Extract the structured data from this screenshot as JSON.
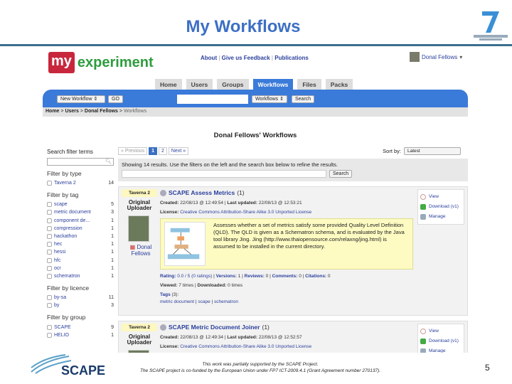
{
  "slide": {
    "title": "My Workflows",
    "page_number": "5",
    "footer_line1": "This work was partially supported by the SCAPE Project.",
    "footer_line2": "The SCAPE project is co-funded by the European Union under FP7 ICT-2009.4.1 (Grant Agreement number 270137).",
    "scape_logo": "SCAPE",
    "fp7_logo": "SEVENTH FRAMEWORK PROGRAMME"
  },
  "header": {
    "logo_my": "my",
    "logo_experiment": "experiment",
    "links": [
      "About",
      "Give us Feedback",
      "Publications"
    ],
    "user": "Donal Fellows"
  },
  "tabs": [
    "Home",
    "Users",
    "Groups",
    "Workflows",
    "Files",
    "Packs"
  ],
  "toolbar": {
    "new_select": "New Workflow",
    "go": "GO",
    "search_scope": "Workflows",
    "search": "Search"
  },
  "breadcrumb": {
    "home": "Home",
    "users": "Users",
    "user": "Donal Fellows",
    "current": "Workflows"
  },
  "page_title": "Donal Fellows' Workflows",
  "sidebar": {
    "search_label": "Search filter terms",
    "groups": [
      {
        "title": "Filter by type",
        "items": [
          {
            "label": "Taverna 2",
            "count": "14"
          }
        ]
      },
      {
        "title": "Filter by tag",
        "items": [
          {
            "label": "scape",
            "count": "5"
          },
          {
            "label": "metric document",
            "count": "3"
          },
          {
            "label": "component de...",
            "count": "1"
          },
          {
            "label": "compression",
            "count": "1"
          },
          {
            "label": "hackathon",
            "count": "1"
          },
          {
            "label": "hec",
            "count": "1"
          },
          {
            "label": "hessi",
            "count": "1"
          },
          {
            "label": "hfc",
            "count": "1"
          },
          {
            "label": "ocr",
            "count": "1"
          },
          {
            "label": "schematron",
            "count": "1"
          }
        ]
      },
      {
        "title": "Filter by licence",
        "items": [
          {
            "label": "by-sa",
            "count": "11"
          },
          {
            "label": "by",
            "count": "3"
          }
        ]
      },
      {
        "title": "Filter by group",
        "items": [
          {
            "label": "SCAPE",
            "count": "9"
          },
          {
            "label": "HELIO",
            "count": "1"
          }
        ]
      }
    ]
  },
  "main": {
    "pager": {
      "prev": "« Previous",
      "p1": "1",
      "p2": "2",
      "next": "Next »"
    },
    "sort_label": "Sort by:",
    "sort_value": "Latest",
    "info": "Showing 14 results. Use the filters on the left and the search box below to refine the results.",
    "search": "Search",
    "cards": [
      {
        "type": "Taverna 2",
        "uploader_label": "Original Uploader",
        "uploader": "Donal Fellows",
        "title": "SCAPE Assess Metrics",
        "count": "(1)",
        "created_label": "Created:",
        "created": "22/08/13 @ 12:49:54",
        "updated_label": "Last updated:",
        "updated": "22/08/13 @ 12:53:21",
        "license_label": "License:",
        "license": "Creative Commons Attribution-Share Alike 3.0 Unported License",
        "description": "Assesses whether a set of metrics satisfy some provided Quality Level Definition (QLD). The QLD is given as a Schematron schema, and is evaluated by the Java tool library Jing. Jing (http://www.thaiopensource.com/relaxng/jing.html) is assumed to be installed in the current directory.",
        "rating_label": "Rating:",
        "rating": "0.0 / 5 (0 ratings)",
        "versions_label": "Versions:",
        "versions": "1",
        "reviews_label": "Reviews:",
        "reviews": "0",
        "comments_label": "Comments:",
        "comments": "0",
        "citations_label": "Citations:",
        "citations": "0",
        "viewed_label": "Viewed:",
        "viewed": "7 times",
        "downloaded_label": "Downloaded:",
        "downloaded": "0 times",
        "tags_label": "Tags",
        "tags_count": "(3):",
        "tags": [
          "metric document",
          "scape",
          "schematron"
        ],
        "actions": [
          "View",
          "Download (v1)",
          "Manage"
        ]
      },
      {
        "type": "Taverna 2",
        "uploader_label": "Original Uploader",
        "title": "SCAPE Metric Document Joiner",
        "count": "(1)",
        "created_label": "Created:",
        "created": "22/08/13 @ 12:49:34",
        "updated_label": "Last updated:",
        "updated": "22/08/13 @ 12:52:57",
        "license_label": "License:",
        "license": "Creative Commons Attribution-Share Alike 3.0 Unported License",
        "actions": [
          "View",
          "Download (v1)",
          "Manage"
        ]
      }
    ]
  }
}
